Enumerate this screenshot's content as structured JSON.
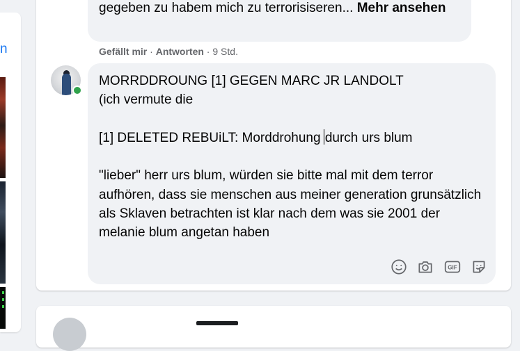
{
  "left_panel": {
    "link_fragment": "n"
  },
  "previous_comment": {
    "text_tail": "gegeben zu habem mich zu terrorisiseren... ",
    "see_more_label": "Mehr ansehen"
  },
  "comment_actions": {
    "like_label": "Gefällt mir",
    "separator": " · ",
    "reply_label": "Antworten",
    "timestamp": "9 Std."
  },
  "composer": {
    "line1": "MORRDDROUNG [1] GEGEN MARC JR LANDOLT",
    "line2": "(ich vermute die",
    "line4_before_caret": "[1] DELETED REBUiLT: Morddrohung ",
    "line4_after_caret": "durch urs blum",
    "paragraph": "\"lieber\" herr urs blum, würden sie bitte mal mit dem terror aufhören, dass sie menschen aus meiner generation grunsätzlich als Sklaven betrachten ist klar nach dem was sie 2001 der melanie blum angetan haben",
    "tools": [
      "emoji-icon",
      "camera-icon",
      "gif-icon",
      "sticker-icon"
    ],
    "tool_gif_text": "GIF"
  },
  "colors": {
    "background": "#f0f2f5",
    "online_dot": "#31a24c",
    "link": "#1877f2",
    "secondary_text": "#65676b"
  }
}
